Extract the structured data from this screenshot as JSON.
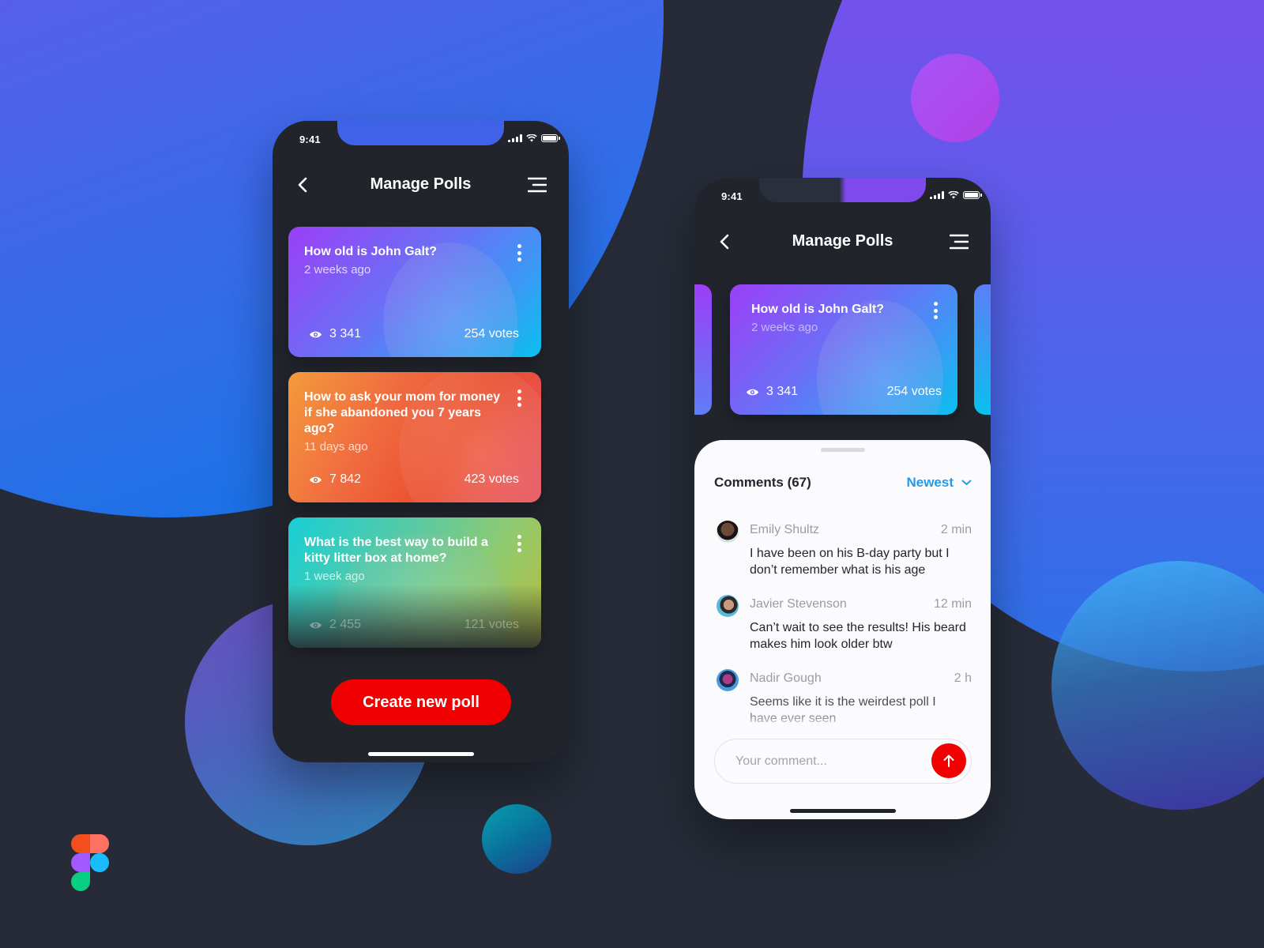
{
  "colors": {
    "accent_red": "#f00000",
    "accent_blue": "#1e9cf0",
    "phone_bg": "#21242b",
    "page_bg": "#262b37"
  },
  "left_phone": {
    "status": {
      "time": "9:41"
    },
    "header": {
      "title": "Manage Polls",
      "back_icon": "chevron-left-icon",
      "menu_icon": "menu-icon"
    },
    "polls": [
      {
        "question": "How old is John Galt?",
        "posted": "2 weeks ago",
        "views": "3 341",
        "votes": "254 votes",
        "theme": "purple-blue"
      },
      {
        "question": "How to ask your mom for money if she abandoned you 7 years ago?",
        "posted": "11 days ago",
        "views": "7 842",
        "votes": "423 votes",
        "theme": "orange-red"
      },
      {
        "question": "What is the best way to build a kitty litter box at home?",
        "posted": "1 week ago",
        "views": "2 455",
        "votes": "121 votes",
        "theme": "teal-green"
      }
    ],
    "create_button": "Create new poll"
  },
  "right_phone": {
    "status": {
      "time": "9:41"
    },
    "header": {
      "title": "Manage Polls"
    },
    "featured_poll": {
      "question": "How old is John Galt?",
      "posted": "2 weeks ago",
      "views": "3 341",
      "votes": "254 votes"
    },
    "comments": {
      "title": "Comments (67)",
      "sort_label": "Newest",
      "items": [
        {
          "name": "Emily Shultz",
          "time": "2 min",
          "text": "I have been on his B-day party but I don’t remember what is his age"
        },
        {
          "name": "Javier Stevenson",
          "time": "12 min",
          "text": "Can’t wait to see the results! His beard makes him look older btw"
        },
        {
          "name": "Nadir Gough",
          "time": "2 h",
          "text": "Seems like it is the weirdest poll I have ever seen"
        }
      ],
      "input_placeholder": "Your comment..."
    }
  }
}
